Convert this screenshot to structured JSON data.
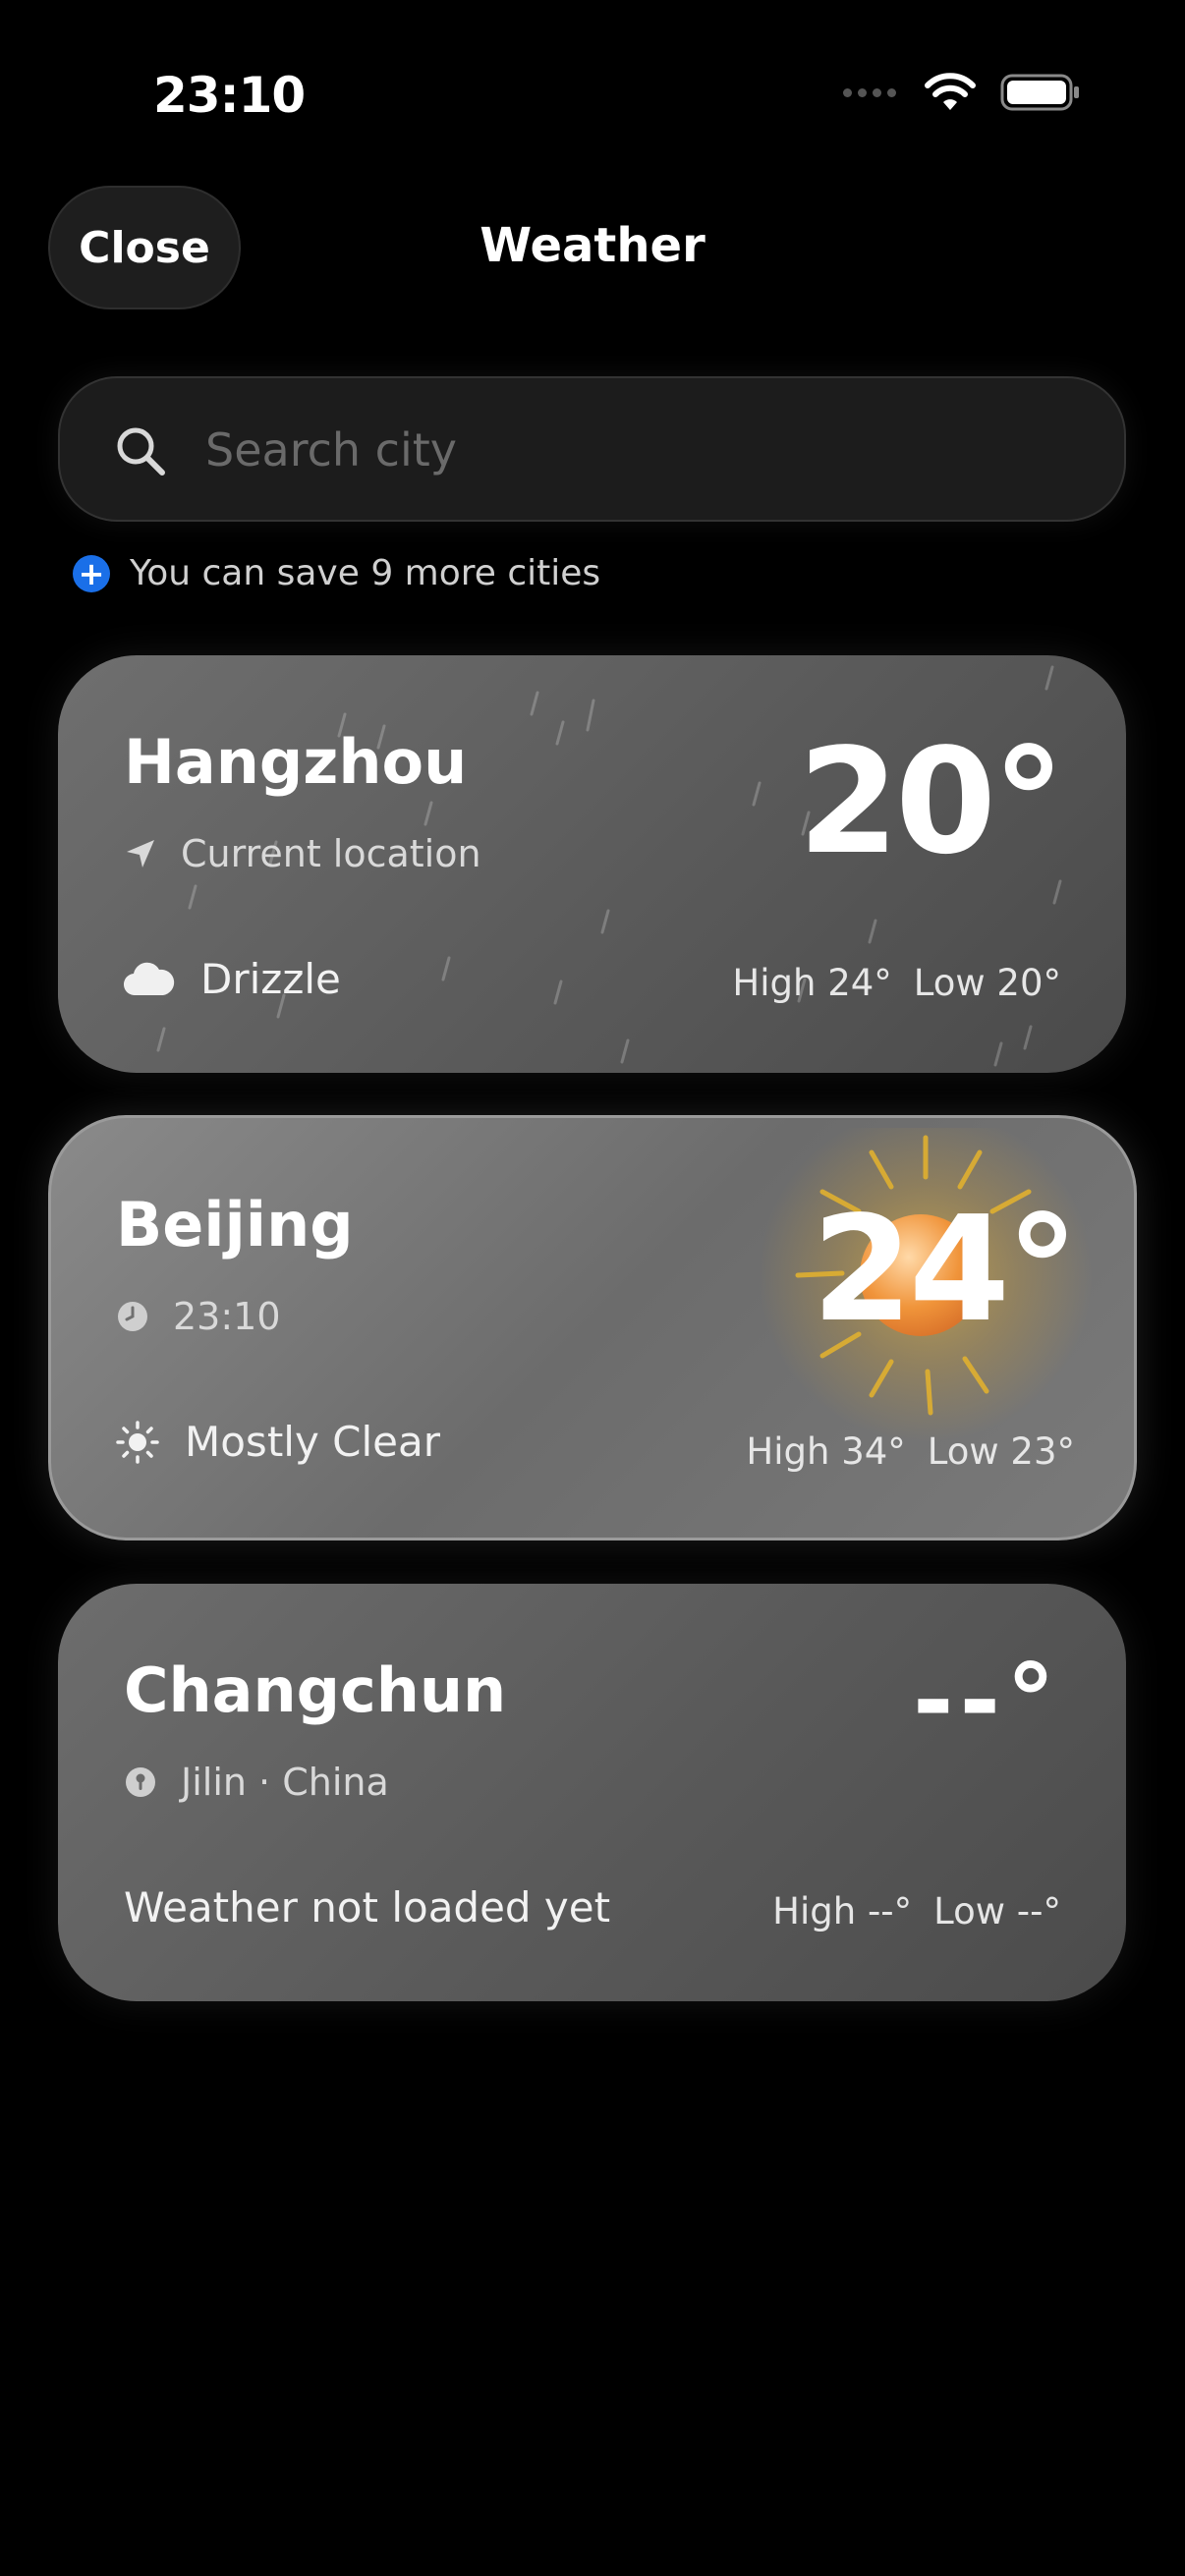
{
  "status_bar": {
    "time": "23:10",
    "icons": [
      "cellular-dots-icon",
      "wifi-icon",
      "battery-icon"
    ]
  },
  "header": {
    "close_label": "Close",
    "title": "Weather"
  },
  "search": {
    "placeholder": "Search city",
    "value": ""
  },
  "save_hint": {
    "text": "You can save 9 more cities",
    "icon": "plus-circle-icon",
    "color": "#1a6fe8"
  },
  "cities": [
    {
      "name": "Hangzhou",
      "subtitle": "Current location",
      "subtitle_icon": "location-arrow-icon",
      "temperature": "20°",
      "condition": "Drizzle",
      "condition_icon": "cloud-icon",
      "high": "High 24°",
      "low": "Low 20°",
      "background": "rain"
    },
    {
      "name": "Beijing",
      "subtitle": "23:10",
      "subtitle_icon": "clock-icon",
      "temperature": "24°",
      "condition": "Mostly Clear",
      "condition_icon": "sun-icon",
      "high": "High 34°",
      "low": "Low 23°",
      "background": "sun",
      "selected": true
    },
    {
      "name": "Changchun",
      "subtitle": "Jilin · China",
      "subtitle_icon": "pin-icon",
      "temperature": "--°",
      "condition": "Weather not loaded yet",
      "high": "High --°",
      "low": "Low --°"
    }
  ]
}
